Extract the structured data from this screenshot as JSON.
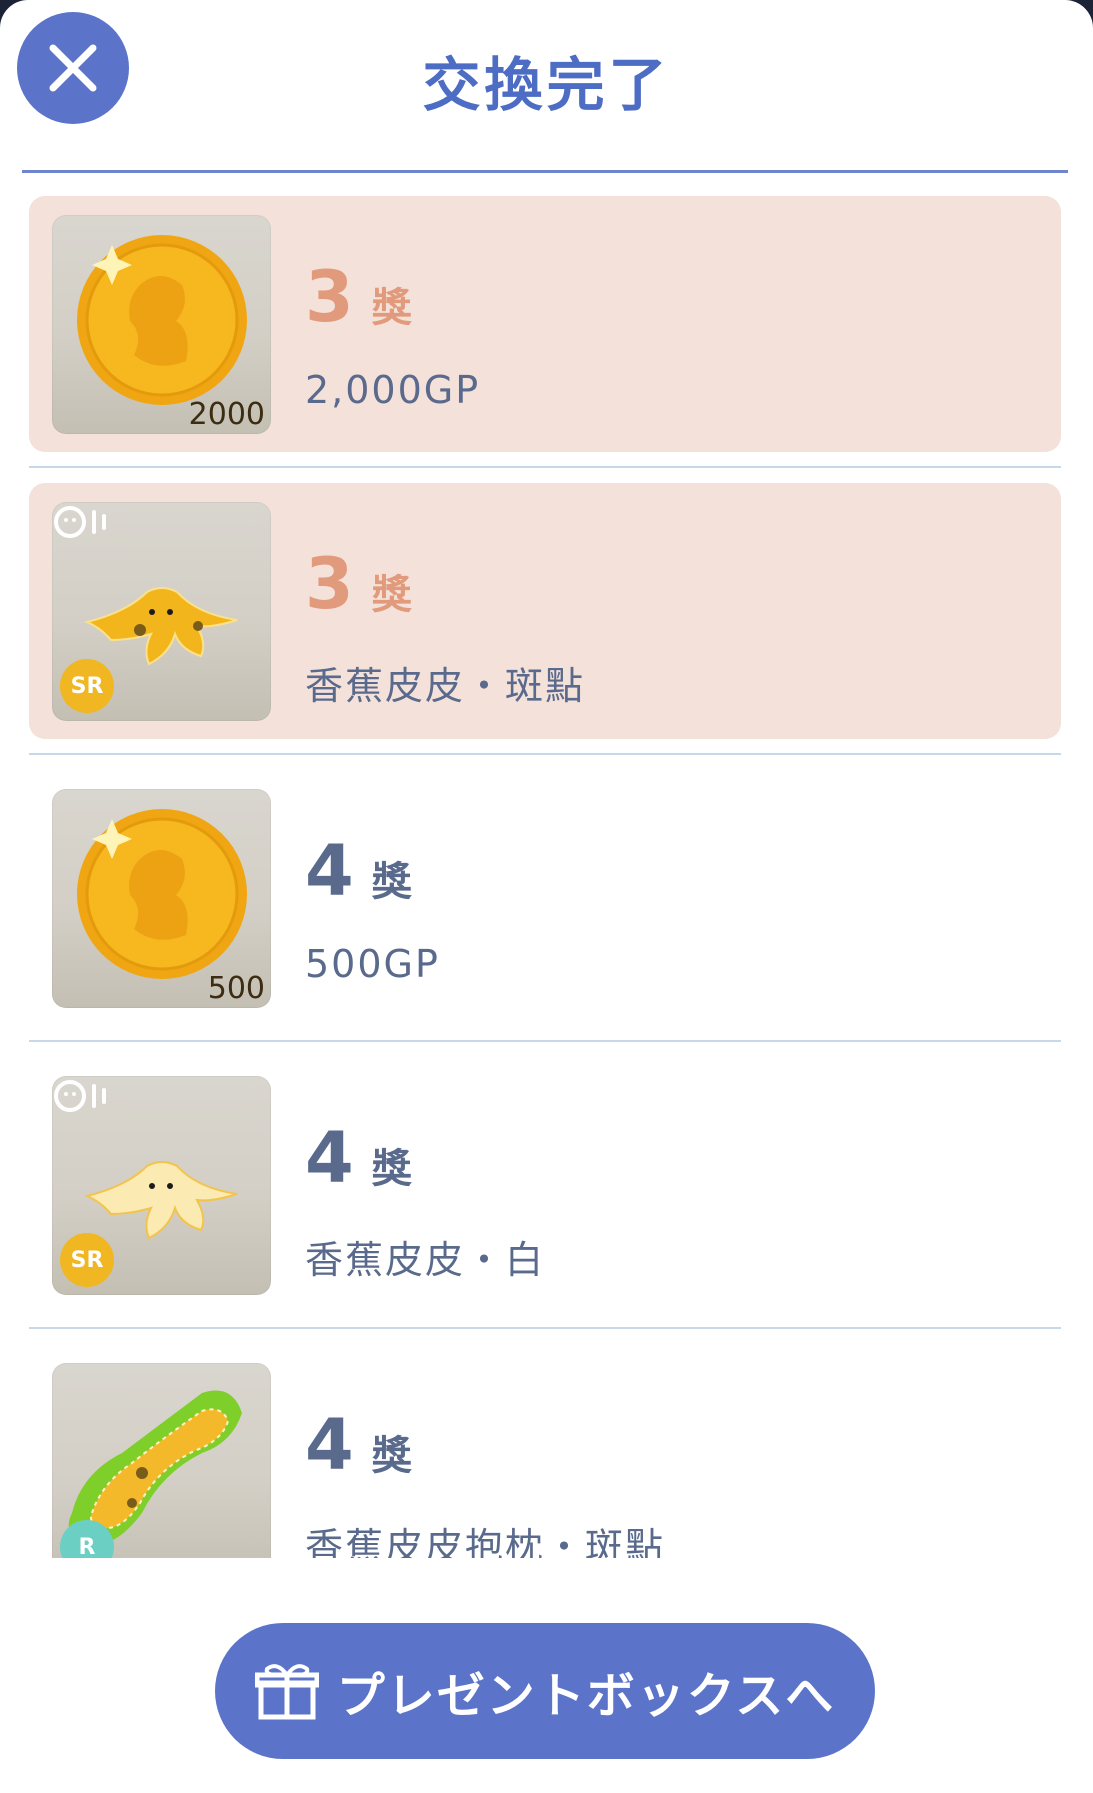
{
  "header": {
    "title": "交換完了",
    "close_icon": "close-x-icon"
  },
  "items": [
    {
      "rank": "3",
      "rank_suffix": "獎",
      "name": "2,000GP",
      "thumb": "gold-coin",
      "amount_tag": "2000",
      "rarity": "",
      "highlighted": true
    },
    {
      "rank": "3",
      "rank_suffix": "獎",
      "name": "香蕉皮皮・斑點",
      "thumb": "banana-peel-spotted",
      "amount_tag": "",
      "rarity": "SR",
      "highlighted": true
    },
    {
      "rank": "4",
      "rank_suffix": "獎",
      "name": "500GP",
      "thumb": "gold-coin",
      "amount_tag": "500",
      "rarity": "",
      "highlighted": false
    },
    {
      "rank": "4",
      "rank_suffix": "獎",
      "name": "香蕉皮皮・白",
      "thumb": "banana-peel-white",
      "amount_tag": "",
      "rarity": "SR",
      "highlighted": false
    },
    {
      "rank": "4",
      "rank_suffix": "獎",
      "name": "香蕉皮皮抱枕・斑點",
      "thumb": "banana-peel-pillow",
      "amount_tag": "",
      "rarity": "R",
      "highlighted": false
    }
  ],
  "footer": {
    "button_label": "プレゼントボックスへ",
    "button_icon": "gift-box-icon"
  },
  "colors": {
    "accent": "#5b74c9",
    "highlight_bg": "#f4e1d9",
    "highlight_rank": "#e29a7c",
    "text": "#5a6a8c"
  }
}
